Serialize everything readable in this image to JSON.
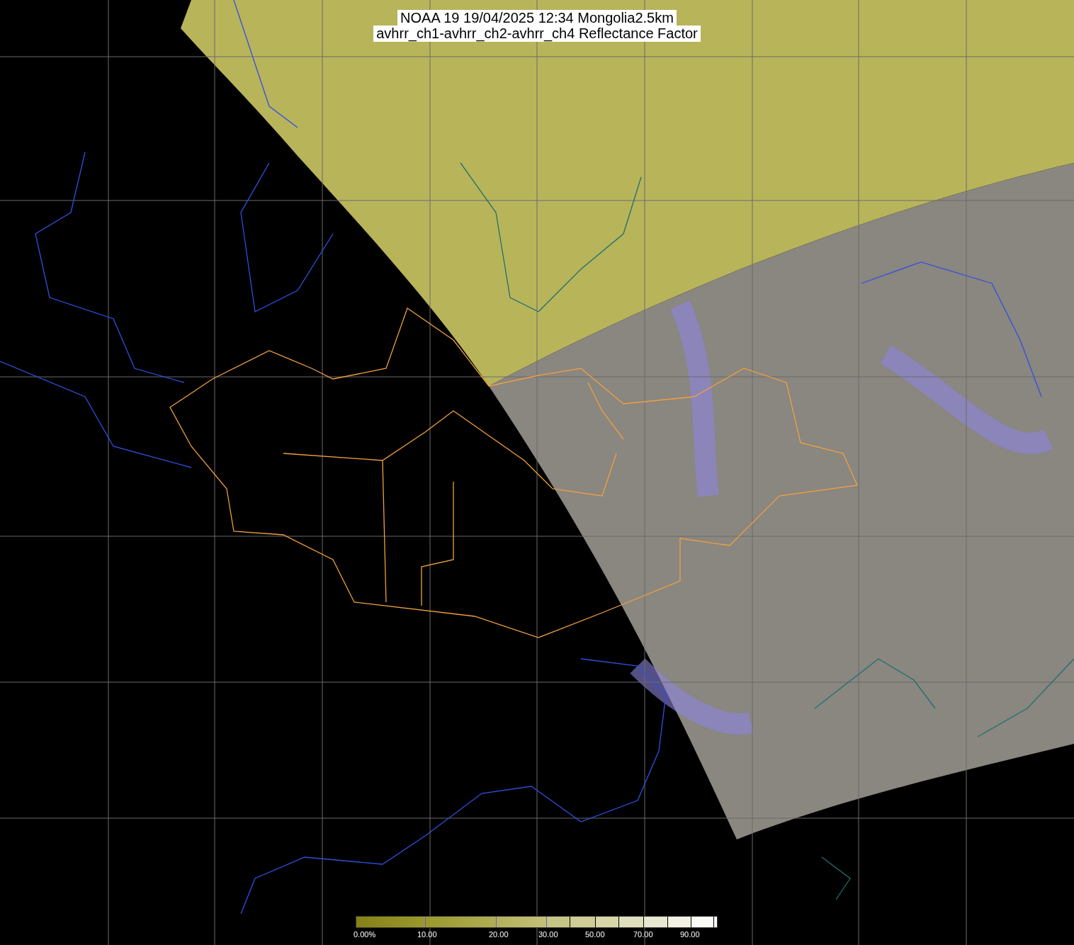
{
  "title": {
    "line_1": "NOAA 19 19/04/2025 12:34 Mongolia2.5km",
    "line_2": "avhrr_ch1-avhrr_ch2-avhrr_ch4 Reflectance Factor"
  },
  "colorbar": {
    "labels": [
      "0.00%",
      "10.00",
      "20.00",
      "30.00",
      "50.00",
      "70.00",
      "90.00"
    ]
  }
}
